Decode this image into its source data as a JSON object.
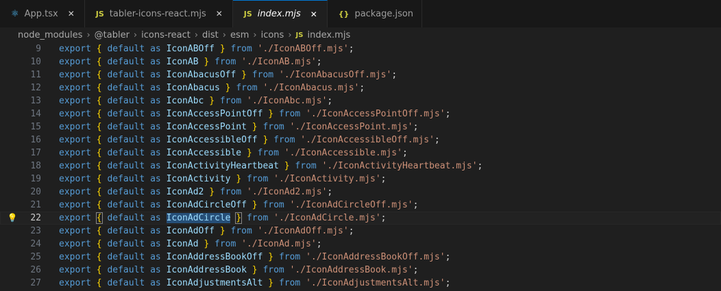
{
  "tabs": [
    {
      "icon": "react-icon",
      "glyph": "⚛",
      "label": "App.tsx",
      "italic": false,
      "active": false
    },
    {
      "icon": "js-file-icon",
      "glyph": "JS",
      "label": "tabler-icons-react.mjs",
      "italic": false,
      "active": false
    },
    {
      "icon": "js-file-icon",
      "glyph": "JS",
      "label": "index.mjs",
      "italic": true,
      "active": true
    },
    {
      "icon": "json-file-icon",
      "glyph": "{}",
      "label": "package.json",
      "italic": false,
      "active": false
    }
  ],
  "breadcrumb": [
    "node_modules",
    "@tabler",
    "icons-react",
    "dist",
    "esm",
    "icons"
  ],
  "breadcrumb_file": {
    "glyph": "JS",
    "label": "index.mjs"
  },
  "current_line": 22,
  "selection": "IconAdCircle",
  "lines": [
    {
      "num": "9",
      "name": "IconABOff",
      "path": "./IconABOff.mjs"
    },
    {
      "num": "10",
      "name": "IconAB",
      "path": "./IconAB.mjs"
    },
    {
      "num": "11",
      "name": "IconAbacusOff",
      "path": "./IconAbacusOff.mjs"
    },
    {
      "num": "12",
      "name": "IconAbacus",
      "path": "./IconAbacus.mjs"
    },
    {
      "num": "13",
      "name": "IconAbc",
      "path": "./IconAbc.mjs"
    },
    {
      "num": "14",
      "name": "IconAccessPointOff",
      "path": "./IconAccessPointOff.mjs"
    },
    {
      "num": "15",
      "name": "IconAccessPoint",
      "path": "./IconAccessPoint.mjs"
    },
    {
      "num": "16",
      "name": "IconAccessibleOff",
      "path": "./IconAccessibleOff.mjs"
    },
    {
      "num": "17",
      "name": "IconAccessible",
      "path": "./IconAccessible.mjs"
    },
    {
      "num": "18",
      "name": "IconActivityHeartbeat",
      "path": "./IconActivityHeartbeat.mjs"
    },
    {
      "num": "19",
      "name": "IconActivity",
      "path": "./IconActivity.mjs"
    },
    {
      "num": "20",
      "name": "IconAd2",
      "path": "./IconAd2.mjs"
    },
    {
      "num": "21",
      "name": "IconAdCircleOff",
      "path": "./IconAdCircleOff.mjs"
    },
    {
      "num": "22",
      "name": "IconAdCircle",
      "path": "./IconAdCircle.mjs"
    },
    {
      "num": "23",
      "name": "IconAdOff",
      "path": "./IconAdOff.mjs"
    },
    {
      "num": "24",
      "name": "IconAd",
      "path": "./IconAd.mjs"
    },
    {
      "num": "25",
      "name": "IconAddressBookOff",
      "path": "./IconAddressBookOff.mjs"
    },
    {
      "num": "26",
      "name": "IconAddressBook",
      "path": "./IconAddressBook.mjs"
    },
    {
      "num": "27",
      "name": "IconAdjustmentsAlt",
      "path": "./IconAdjustmentsAlt.mjs"
    }
  ],
  "keywords": {
    "export": "export",
    "default": "default",
    "as": "as",
    "from": "from"
  },
  "colors": {
    "keyword": "#569cd6",
    "identifier": "#9cdcfe",
    "string": "#ce9178",
    "brace": "#ffd700",
    "accent": "#0078d4"
  }
}
